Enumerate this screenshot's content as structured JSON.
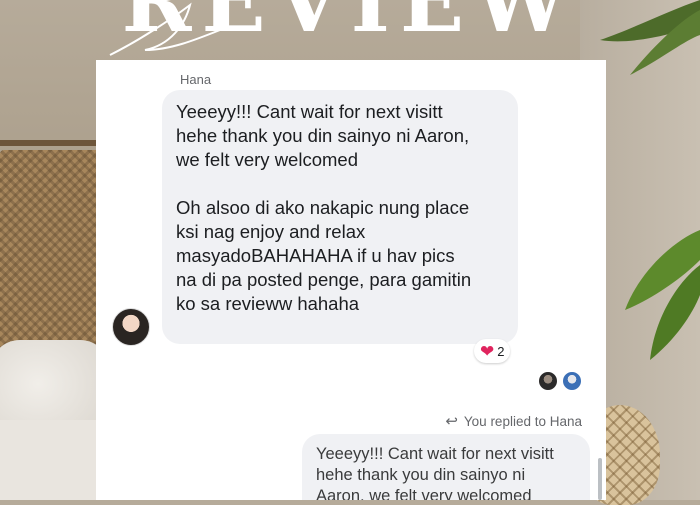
{
  "header": {
    "title": "REVIEW"
  },
  "chat": {
    "sender": "Hana",
    "incoming_message": "Yeeeyy!!! Cant wait for next visitt\nhehe thank you din sainyo ni Aaron,\nwe felt very welcomed\n\nOh alsoo di ako nakapic nung place\nksi nag enjoy and relax\nmasyadoBAHAHAHA if u hav pics\nna di pa posted penge, para gamitin\nko sa revieww hahaha",
    "reaction": {
      "icon": "heart-icon",
      "count": "2"
    },
    "reply_note": "You replied to Hana",
    "quoted_message": "Yeeeyy!!! Cant wait for next visitt\nhehe thank you din sainyo ni\nAaron, we felt very welcomed"
  },
  "colors": {
    "bubble": "#f0f1f4",
    "text": "#1c1e21",
    "meta": "#65676b",
    "heart": "#e0245e"
  }
}
